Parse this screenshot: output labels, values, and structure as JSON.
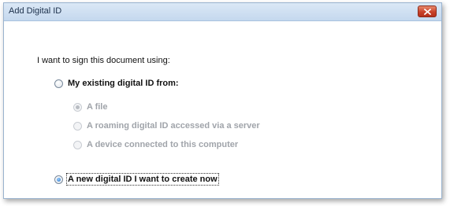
{
  "window": {
    "title": "Add Digital ID"
  },
  "prompt": "I want to sign this document using:",
  "options": {
    "existing": {
      "label": "My existing digital ID from:",
      "selected": false
    },
    "file": {
      "label": "A file",
      "selected": true
    },
    "server": {
      "label": "A roaming digital ID accessed via a server",
      "selected": false
    },
    "device": {
      "label": "A device connected to this computer",
      "selected": false
    },
    "new_id": {
      "label": "A new digital ID I want to create now",
      "selected": true
    }
  },
  "colors": {
    "accent": "#1f6fc6",
    "close": "#c8422a",
    "titlebar": "#c4d8ee"
  }
}
